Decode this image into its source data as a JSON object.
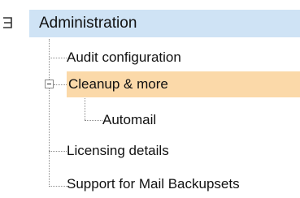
{
  "tree": {
    "root": {
      "label": "Administration",
      "expanded": true,
      "toggle_icon": "collapse-icon"
    },
    "items": [
      {
        "label": "Audit configuration"
      },
      {
        "label": "Cleanup & more",
        "selected": true,
        "expanded": true,
        "toggle_icon": "collapse-box-icon"
      },
      {
        "label": "Automail",
        "level": 2
      },
      {
        "label": "Licensing details"
      },
      {
        "label": "Support for Mail Backupsets"
      }
    ],
    "colors": {
      "root_highlight": "#cfe3f5",
      "selected_highlight": "#fbd9a9",
      "connector_lines": "#8c8c8c"
    }
  }
}
